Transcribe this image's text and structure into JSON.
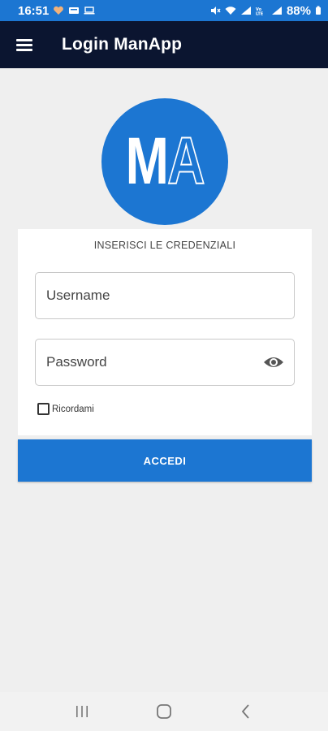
{
  "status_bar": {
    "time": "16:51",
    "battery": "88%",
    "icons": [
      "heart-icon",
      "notification-icon",
      "laptop-icon",
      "mute-icon",
      "wifi-icon",
      "signal-icon",
      "lte-icon",
      "signal-icon",
      "battery-icon"
    ]
  },
  "app_bar": {
    "menu_icon": "hamburger-menu-icon",
    "title": "Login ManApp"
  },
  "logo": {
    "letter_solid": "M",
    "letter_outline": "A"
  },
  "form": {
    "heading": "INSERISCI LE CREDENZIALI",
    "username_placeholder": "Username",
    "password_placeholder": "Password",
    "password_toggle_icon": "eye-icon",
    "remember_label": "Ricordami",
    "remember_checked": false,
    "submit_label": "ACCEDI"
  },
  "nav_bar": {
    "buttons": [
      "recent-apps-icon",
      "home-icon",
      "back-icon"
    ]
  },
  "colors": {
    "accent": "#1c76d2",
    "app_bar": "#0b1530",
    "background": "#efefef"
  }
}
